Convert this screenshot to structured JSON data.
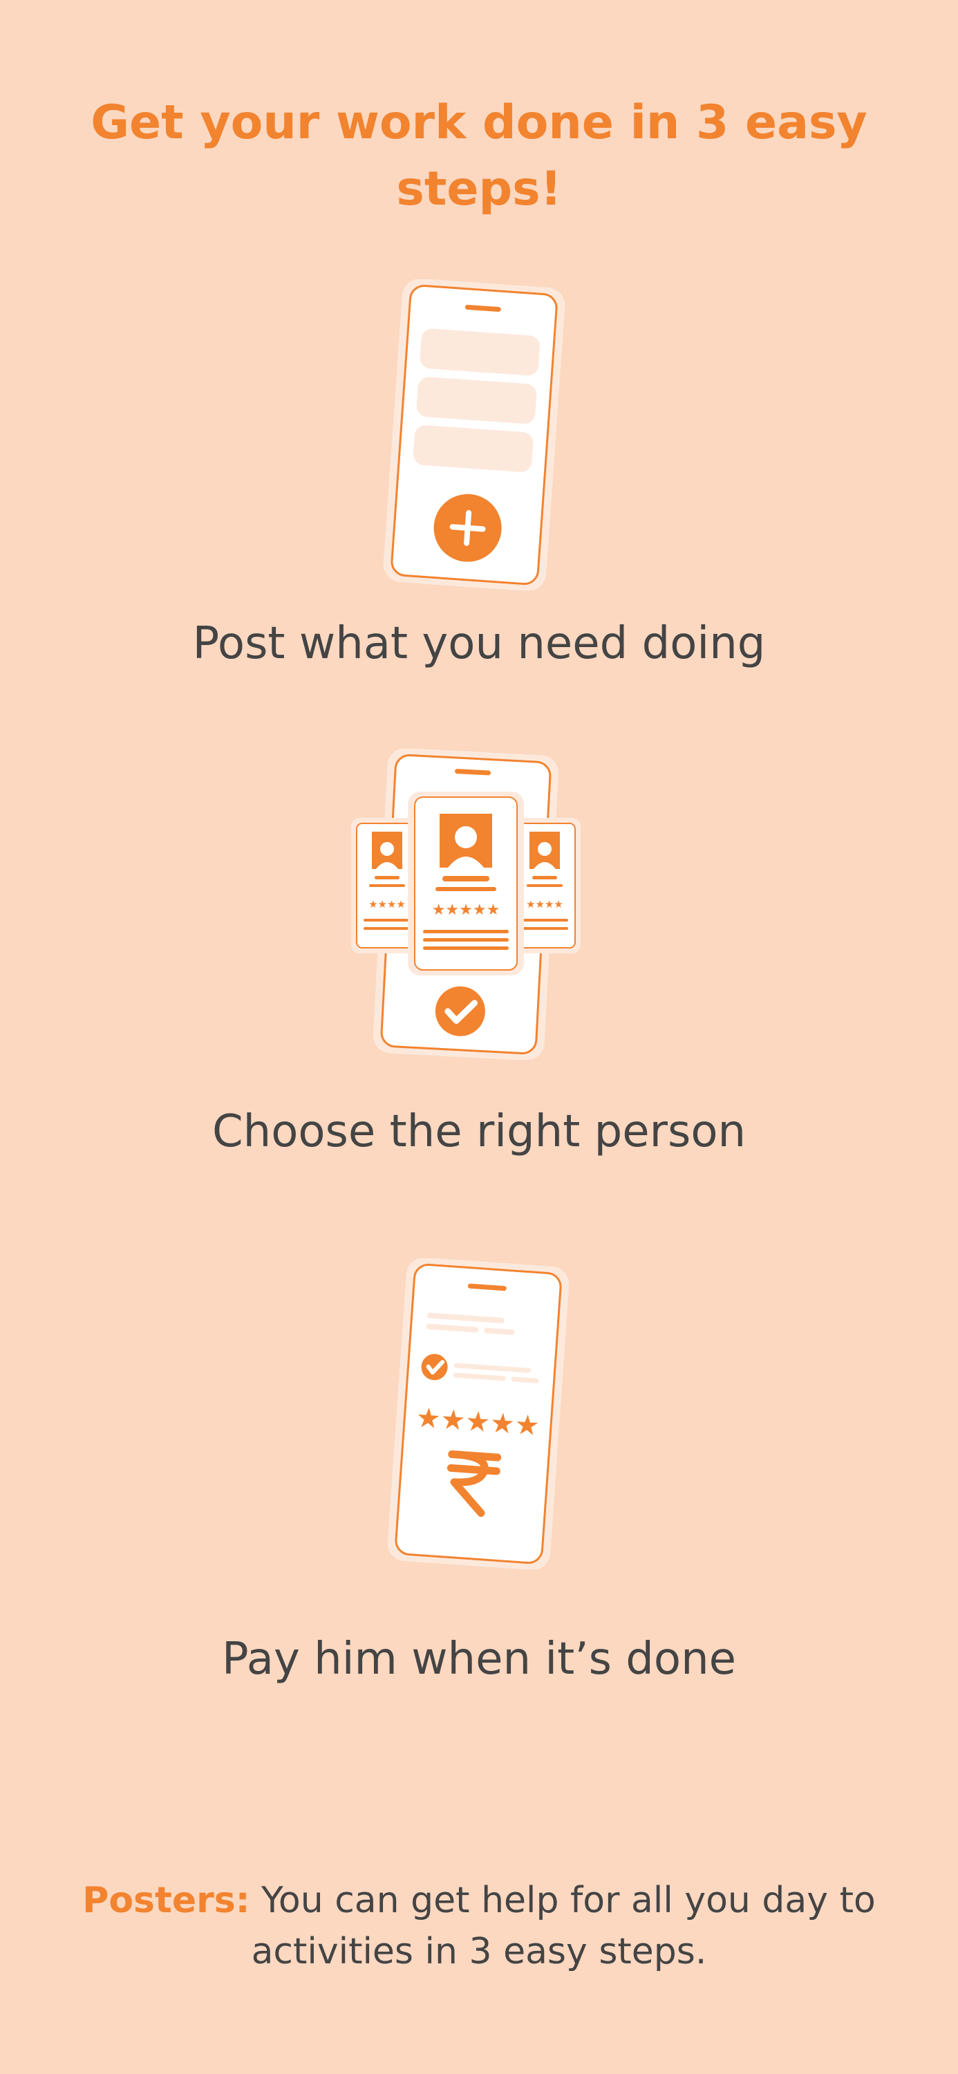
{
  "colors": {
    "background": "#FCD8C1",
    "accent": "#F2832F",
    "text": "#444444",
    "card": "#FFFFFF",
    "soft": "#FDE9DC"
  },
  "title": {
    "line1": "Get your work done in 3 easy",
    "line2": "steps!"
  },
  "steps": [
    {
      "label": "Post what you need doing",
      "icon": "phone-post-plus-icon"
    },
    {
      "label": "Choose the right person",
      "icon": "phone-profile-cards-icon"
    },
    {
      "label": "Pay him when it’s done",
      "icon": "phone-payment-rupee-icon"
    }
  ],
  "footer": {
    "lead": "Posters:",
    "line1": "You can get help for all you day to",
    "line2": "activities in 3 easy steps."
  }
}
